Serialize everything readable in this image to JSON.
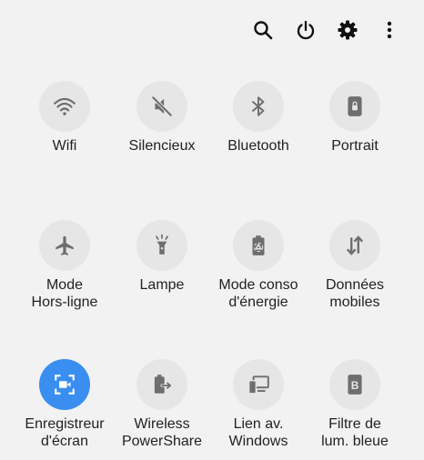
{
  "toolbar": {
    "icons": [
      "search-icon",
      "power-icon",
      "gear-icon",
      "more-vert-icon"
    ]
  },
  "tiles": [
    {
      "label": "Wifi",
      "icon": "wifi-icon",
      "active": false
    },
    {
      "label": "Silencieux",
      "icon": "volume-mute-icon",
      "active": false
    },
    {
      "label": "Bluetooth",
      "icon": "bluetooth-icon",
      "active": false
    },
    {
      "label": "Portrait",
      "icon": "rotation-lock-icon",
      "active": false
    },
    {
      "label": "Mode\nHors-ligne",
      "icon": "airplane-icon",
      "active": false
    },
    {
      "label": "Lampe",
      "icon": "flashlight-icon",
      "active": false
    },
    {
      "label": "Mode conso\nd'énergie",
      "icon": "battery-saver-icon",
      "active": false
    },
    {
      "label": "Données\nmobiles",
      "icon": "mobile-data-icon",
      "active": false
    },
    {
      "label": "Enregistreur\nd'écran",
      "icon": "screen-recorder-icon",
      "active": true
    },
    {
      "label": "Wireless\nPowerShare",
      "icon": "wireless-powershare-icon",
      "active": false
    },
    {
      "label": "Lien av.\nWindows",
      "icon": "link-to-windows-icon",
      "active": false
    },
    {
      "label": "Filtre de\nlum. bleue",
      "icon": "blue-light-filter-icon",
      "active": false
    }
  ],
  "colors": {
    "active": "#3a8ef0",
    "tile_bg": "#e6e6e6",
    "icon": "#6e6e6e"
  }
}
